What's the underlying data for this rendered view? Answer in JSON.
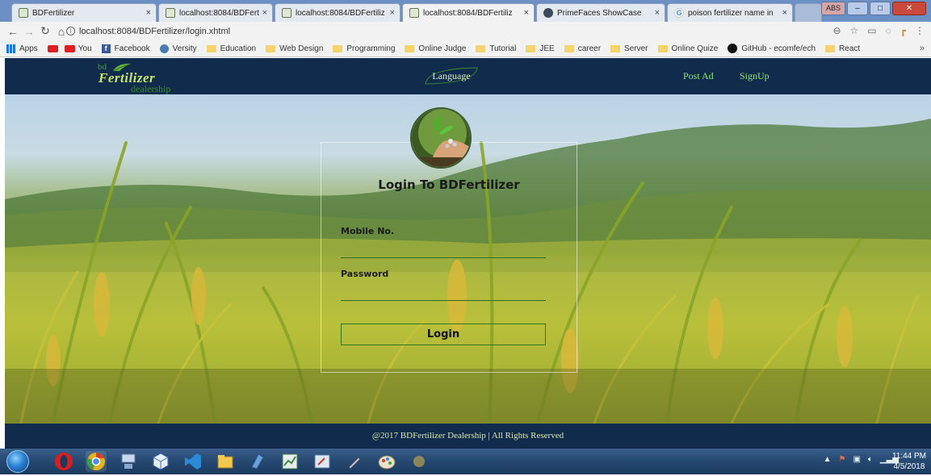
{
  "browser": {
    "tabs": [
      {
        "title": "BDFertilizer",
        "active": false,
        "favicon": "site-icon"
      },
      {
        "title": "localhost:8084/BDFertiliz",
        "active": false,
        "favicon": "site-icon"
      },
      {
        "title": "localhost:8084/BDFertiliz",
        "active": false,
        "favicon": "site-icon"
      },
      {
        "title": "localhost:8084/BDFertiliz",
        "active": true,
        "favicon": "site-icon"
      },
      {
        "title": "PrimeFaces ShowCase",
        "active": false,
        "favicon": "primefaces-icon"
      },
      {
        "title": "poison fertilizer name in",
        "active": false,
        "favicon": "google-icon"
      }
    ],
    "window_button": "ABS",
    "url": "localhost:8084/BDFertilizer/login.xhtml",
    "bookmarks": [
      {
        "label": "Apps",
        "icon": "apps-icon"
      },
      {
        "label": "",
        "icon": "youtube-icon"
      },
      {
        "label": "You",
        "icon": "youtube-icon"
      },
      {
        "label": "Facebook",
        "icon": "facebook-icon"
      },
      {
        "label": "Versity",
        "icon": "versity-icon"
      },
      {
        "label": "Education",
        "icon": "folder-icon"
      },
      {
        "label": "Web Design",
        "icon": "folder-icon"
      },
      {
        "label": "Programming",
        "icon": "folder-icon"
      },
      {
        "label": "Online Judge",
        "icon": "folder-icon"
      },
      {
        "label": "Tutorial",
        "icon": "folder-icon"
      },
      {
        "label": "JEE",
        "icon": "folder-icon"
      },
      {
        "label": "career",
        "icon": "folder-icon"
      },
      {
        "label": "Server",
        "icon": "folder-icon"
      },
      {
        "label": "Online Quize",
        "icon": "folder-icon"
      },
      {
        "label": "GitHub - ecomfe/ech",
        "icon": "github-icon"
      },
      {
        "label": "React",
        "icon": "folder-icon"
      }
    ],
    "bookmarks_more": "»"
  },
  "site": {
    "logo": {
      "bd": "bd",
      "name": "Fertilizer",
      "dealer": "dealership"
    },
    "nav": {
      "language": "Language",
      "post_ad": "Post Ad",
      "signup": "SignUp"
    },
    "login": {
      "title": "Login To BDFertilizer",
      "mobile_label": "Mobile No.",
      "mobile_value": "",
      "password_label": "Password",
      "password_value": "",
      "button": "Login"
    },
    "footer": "@2017 BDFertilizer Dealership | All Rights Reserved"
  },
  "taskbar": {
    "time": "11:44 PM",
    "date": "4/5/2018"
  }
}
